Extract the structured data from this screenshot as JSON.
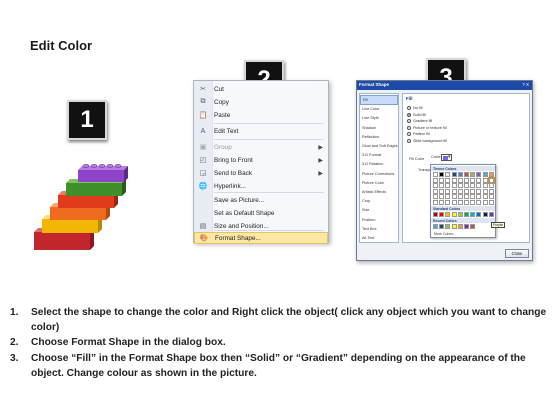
{
  "title": "Edit Color",
  "steps_boxes": [
    "1",
    "2",
    "3"
  ],
  "context_menu": {
    "items": [
      {
        "label": "Cut",
        "icon": "scissors-icon",
        "glyph": "✂",
        "color": "#4a5f80"
      },
      {
        "label": "Copy",
        "icon": "copy-icon",
        "glyph": "⧉",
        "color": "#4a5f80"
      },
      {
        "label": "Paste",
        "icon": "paste-icon",
        "glyph": "📋",
        "color": "#4a5f80"
      },
      {
        "label": "Edit Text",
        "icon": "edit-text-icon",
        "glyph": "A",
        "color": "#4a5f80"
      },
      {
        "label": "Group",
        "icon": "group-icon",
        "glyph": "▣",
        "color": "#9aa",
        "disabled": true,
        "submenu": true
      },
      {
        "label": "Bring to Front",
        "icon": "bring-to-front-icon",
        "glyph": "◰",
        "color": "#4a5f80",
        "submenu": true
      },
      {
        "label": "Send to Back",
        "icon": "send-to-back-icon",
        "glyph": "◲",
        "color": "#4a5f80",
        "submenu": true
      },
      {
        "label": "Hyperlink...",
        "icon": "hyperlink-icon",
        "glyph": "🌐",
        "color": "#4a5f80"
      },
      {
        "label": "Save as Picture...",
        "icon": "",
        "glyph": "",
        "color": "#4a5f80"
      },
      {
        "label": "Set as Default Shape",
        "icon": "",
        "glyph": "",
        "color": "#4a5f80"
      },
      {
        "label": "Size and Position...",
        "icon": "size-position-icon",
        "glyph": "▤",
        "color": "#4a5f80"
      },
      {
        "label": "Format Shape...",
        "icon": "format-shape-icon",
        "glyph": "🎨",
        "color": "#4a5f80",
        "highlighted": true
      }
    ]
  },
  "format_dialog": {
    "title": "Format Shape",
    "help": "? X",
    "nav": [
      "Fill",
      "Line Color",
      "Line Style",
      "Shadow",
      "Reflection",
      "Glow and Soft Edges",
      "3-D Format",
      "3-D Rotation",
      "Picture Corrections",
      "Picture Color",
      "Artistic Effects",
      "Crop",
      "Size",
      "Position",
      "Text Box",
      "Alt Text"
    ],
    "pane_title": "Fill",
    "options": [
      "No fill",
      "Solid fill",
      "Gradient fill",
      "Picture or texture fill",
      "Pattern fill",
      "Slide background fill"
    ],
    "fill_color_label": "Fill Color",
    "color_label": "Color:",
    "transparency_label": "Transpar",
    "palette": {
      "theme_header": "Theme Colors",
      "standard_header": "Standard Colors",
      "recent_header": "Recent Colors",
      "more_colors": "More Colors...",
      "tooltip": "Purple",
      "theme_top": [
        "#ffffff",
        "#000000",
        "#eeece1",
        "#1f497d",
        "#4f81bd",
        "#c0504d",
        "#9bbb59",
        "#8064a2",
        "#4bacc6",
        "#f79646"
      ],
      "standard": [
        "#c00000",
        "#ff0000",
        "#ffc000",
        "#ffff00",
        "#92d050",
        "#00b050",
        "#00b0f0",
        "#0070c0",
        "#002060",
        "#7030a0"
      ],
      "recent": [
        "#4bacc6",
        "#1f497d",
        "#9bbb59",
        "#ffff00",
        "#f79646",
        "#7030a0",
        "#c0504d"
      ]
    },
    "close_label": "Close"
  },
  "instructions": [
    {
      "num": "1.",
      "text": "Select the shape to change the color and Right click the object( click any object which you want to change color)"
    },
    {
      "num": "2.",
      "text": "Choose Format Shape in the dialog box."
    },
    {
      "num": "3.",
      "text": "Choose “Fill” in the Format Shape box then “Solid” or “Gradient” depending on the appearance of the object. Change colour as shown in the picture."
    }
  ],
  "lego_colors": [
    "#c1272d",
    "#f2b705",
    "#ef6b1e",
    "#e23b1b",
    "#3f8f2b",
    "#8e44c8"
  ]
}
